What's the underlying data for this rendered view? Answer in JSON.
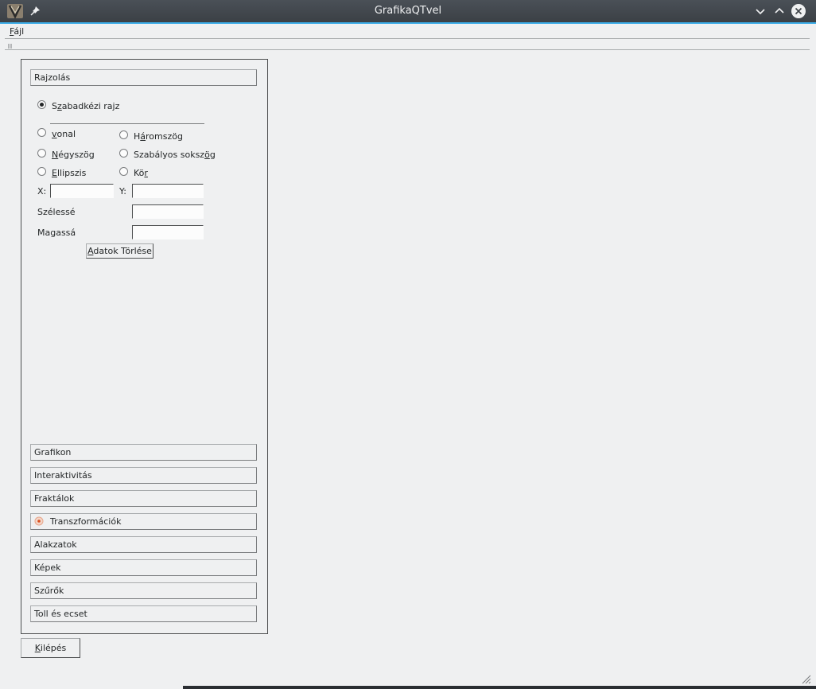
{
  "window": {
    "title": "GrafikaQTvel",
    "app_icon": "grafika-app-icon",
    "pin_icon": "pin-icon",
    "minimize_icon": "chevron-down-icon",
    "maximize_icon": "chevron-up-icon",
    "close_icon": "close-circle-icon",
    "accent_color": "#3daee9"
  },
  "menubar": {
    "file_label_u": "F",
    "file_label_rest": "ájl"
  },
  "toolbox": {
    "sections": {
      "rajzolas": "Rajzolás",
      "grafikon": "Grafikon",
      "interaktivitas": "Interaktivitás",
      "fraktalok": "Fraktálok",
      "transzformaciok": "Transzformációk",
      "alakzatok": "Alakzatok",
      "kepek": "Képek",
      "szurok": "Szűrők",
      "toll_es_ecset": "Toll és ecset"
    },
    "rajzolas": {
      "freehand": {
        "pre": "S",
        "u": "z",
        "post": "abadkézi rajz",
        "checked": true
      },
      "vonal": {
        "pre": "",
        "u": "v",
        "post": "onal",
        "checked": false
      },
      "haromszog": {
        "pre": "H",
        "u": "á",
        "post": "romszög",
        "checked": false
      },
      "negyszog": {
        "pre": "",
        "u": "N",
        "post": "égyszög",
        "checked": false
      },
      "szabalyos": {
        "pre": "Szabályos soksz",
        "u": "ö",
        "post": "g",
        "checked": false
      },
      "ellipszis": {
        "pre": "",
        "u": "E",
        "post": "llipszis",
        "checked": false
      },
      "kor": {
        "pre": "Kö",
        "u": "r",
        "post": "",
        "checked": false
      },
      "x_label": "X:",
      "y_label": "Y:",
      "x_value": "",
      "y_value": "",
      "width_label": "Szélesség",
      "width_value": "",
      "height_label": "Magasság",
      "height_value": "",
      "clear_button_u": "A",
      "clear_button_rest": "datok Törlése"
    }
  },
  "exit_button_u": "K",
  "exit_button_rest": "ilépés"
}
